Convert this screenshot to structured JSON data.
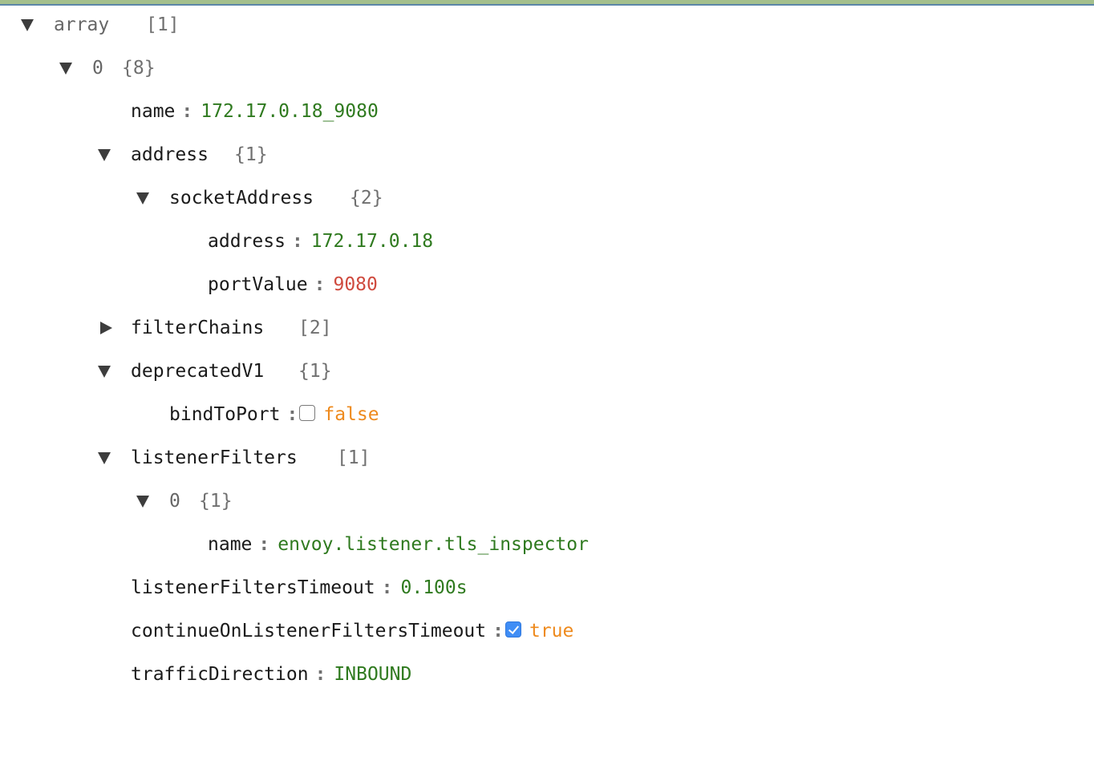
{
  "tree": {
    "root": {
      "key": "array",
      "count": "[1]",
      "expanded": true
    },
    "item0": {
      "key": "0",
      "count": "{8}",
      "expanded": true
    },
    "name": {
      "key": "name",
      "colon": ":",
      "value": "172.17.0.18_9080"
    },
    "address": {
      "key": "address",
      "count": "{1}",
      "expanded": true
    },
    "socketAddress": {
      "key": "socketAddress",
      "count": "{2}",
      "expanded": true
    },
    "socketAddress_address": {
      "key": "address",
      "colon": ":",
      "value": "172.17.0.18"
    },
    "socketAddress_portValue": {
      "key": "portValue",
      "colon": ":",
      "value": "9080"
    },
    "filterChains": {
      "key": "filterChains",
      "count": "[2]",
      "expanded": false
    },
    "deprecatedV1": {
      "key": "deprecatedV1",
      "count": "{1}",
      "expanded": true
    },
    "bindToPort": {
      "key": "bindToPort",
      "colon": ":",
      "value": "false",
      "checked": false
    },
    "listenerFilters": {
      "key": "listenerFilters",
      "count": "[1]",
      "expanded": true
    },
    "listenerFilters0": {
      "key": "0",
      "count": "{1}",
      "expanded": true
    },
    "listenerFilters0_name": {
      "key": "name",
      "colon": ":",
      "value": "envoy.listener.tls_inspector"
    },
    "listenerFiltersTimeout": {
      "key": "listenerFiltersTimeout",
      "colon": ":",
      "value": "0.100s"
    },
    "continueOnListenerFiltersTimeout": {
      "key": "continueOnListenerFiltersTimeout",
      "colon": ":",
      "value": "true",
      "checked": true
    },
    "trafficDirection": {
      "key": "trafficDirection",
      "colon": ":",
      "value": "INBOUND"
    }
  },
  "colors": {
    "string": "#2f7a1f",
    "number": "#cf4a3e",
    "boolean": "#ee8a1d",
    "count": "#707070",
    "checkbox_checked": "#3f8df5",
    "top_bar": "#a3bf8c"
  },
  "icons": {
    "expanded": "triangle-down-icon",
    "collapsed": "triangle-right-icon"
  }
}
